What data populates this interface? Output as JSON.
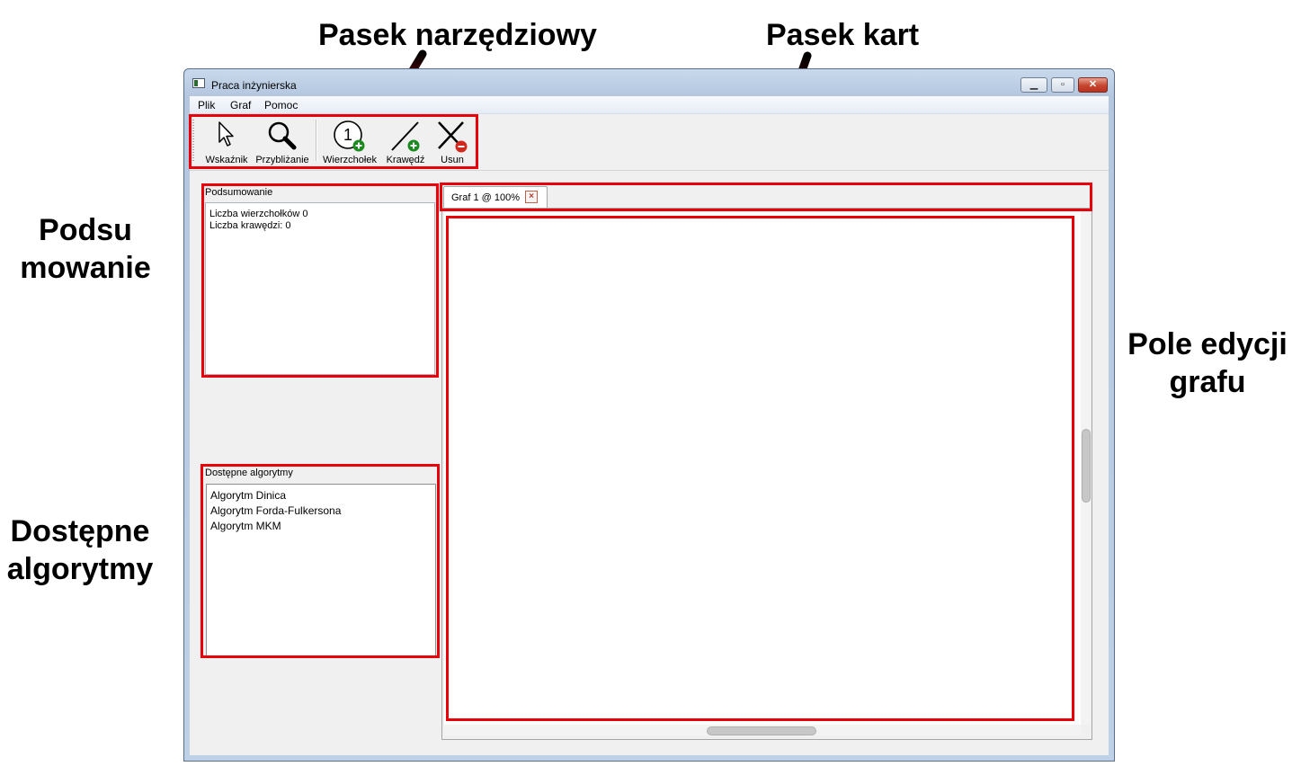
{
  "callouts": {
    "toolbar": "Pasek narzędziowy",
    "tabbar": "Pasek kart",
    "summary_line1": "Podsu",
    "summary_line2": "mowanie",
    "editor_line1": "Pole edycji",
    "editor_line2": "grafu",
    "algorithms_line1": "Dostępne",
    "algorithms_line2": "algorytmy"
  },
  "window": {
    "title": "Praca inżynierska"
  },
  "menu": [
    "Plik",
    "Graf",
    "Pomoc"
  ],
  "toolbar": {
    "items": [
      {
        "label": "Wskaźnik",
        "icon": "pointer-icon"
      },
      {
        "label": "Przybliżanie",
        "icon": "magnifier-icon"
      },
      {
        "label": "Wierzchołek",
        "icon": "add-vertex-icon",
        "icon_text": "1"
      },
      {
        "label": "Krawędź",
        "icon": "add-edge-icon"
      },
      {
        "label": "Usun",
        "icon": "delete-icon"
      }
    ]
  },
  "summary": {
    "title": "Podsumowanie",
    "lines": [
      "Liczba wierzchołków 0",
      "Liczba krawędzi: 0"
    ]
  },
  "algorithms": {
    "title": "Dostępne algorytmy",
    "items": [
      "Algorytm Dinica",
      "Algorytm Forda-Fulkersona",
      "Algorytm MKM"
    ]
  },
  "tabs": [
    {
      "label": "Graf 1 @ 100%",
      "active": true
    }
  ],
  "colors": {
    "highlight": "#e8000b",
    "add_badge": "#1b8a1f",
    "remove_badge": "#d0281d"
  }
}
